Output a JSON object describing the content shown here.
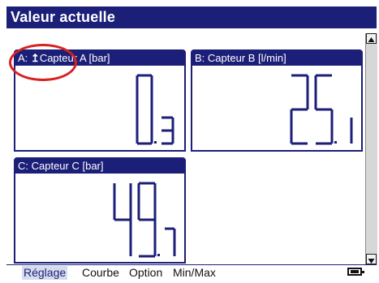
{
  "title": "Valeur actuelle",
  "panels": [
    {
      "label_prefix": "A: ",
      "label_icon": "↥",
      "label_main": "Capteur A [bar]",
      "value": "0.3",
      "int": "0",
      "dec": "3"
    },
    {
      "label": "B: Capteur B [l/min]",
      "value": "25.1",
      "int": "25",
      "dec": "1"
    },
    {
      "label": "C: Capteur C [bar]",
      "value": "49.7",
      "int": "49",
      "dec": "7"
    }
  ],
  "menu": [
    "Réglage",
    "Courbe",
    "Option",
    "Min/Max"
  ],
  "icons": {
    "scroll_up": "triangle-up-icon",
    "scroll_down": "triangle-down-icon",
    "battery": "battery-icon",
    "sensor": "up-arrow-icon"
  },
  "colors": {
    "accent": "#1c1f78",
    "highlight": "#d82020",
    "menu_selected_bg": "#d5dced"
  }
}
